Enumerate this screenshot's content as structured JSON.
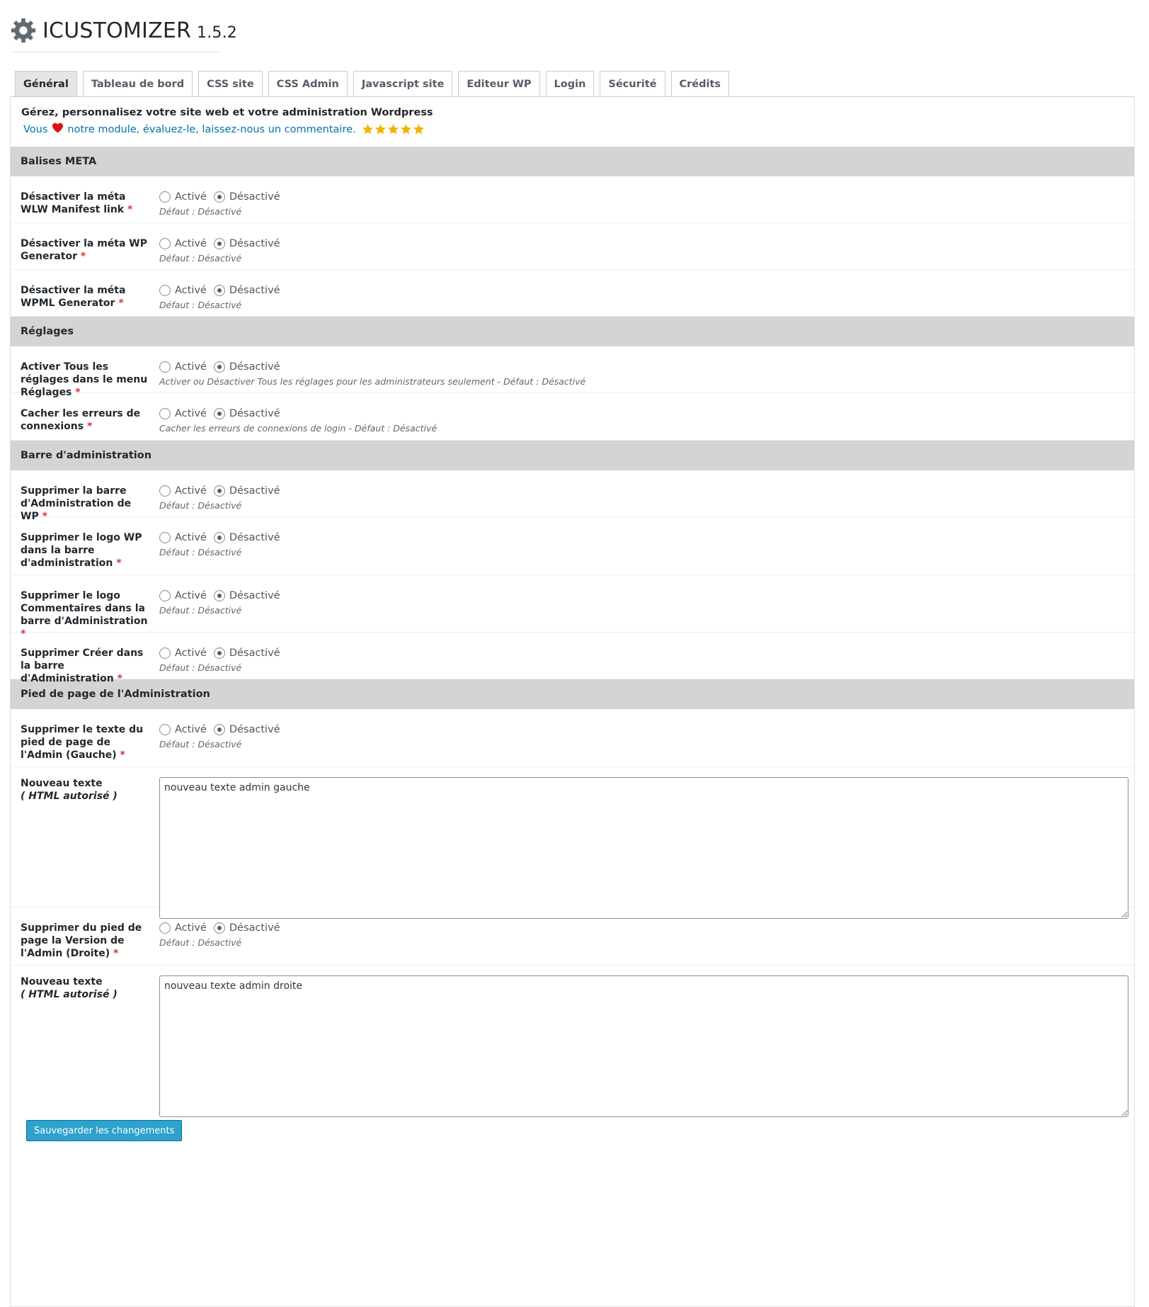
{
  "app": {
    "title": "ICUSTOMIZER",
    "version": "1.5.2"
  },
  "tabs": [
    {
      "label": "Général",
      "active": true
    },
    {
      "label": "Tableau de bord"
    },
    {
      "label": "CSS site"
    },
    {
      "label": "CSS Admin"
    },
    {
      "label": "Javascript site"
    },
    {
      "label": "Editeur WP"
    },
    {
      "label": "Login"
    },
    {
      "label": "Sécurité"
    },
    {
      "label": "Crédits"
    }
  ],
  "intro": {
    "title": "Gérez, personnalisez votre site web et votre administration Wordpress",
    "love_prefix": "Vous",
    "love_suffix": "notre module, évaluez-le, laissez-nous un commentaire.",
    "stars": 5
  },
  "radio_labels": {
    "on": "Activé",
    "off": "Désactivé"
  },
  "sections": [
    {
      "title": "Balises META",
      "rows": [
        {
          "label": "Désactiver la méta WLW Manifest link",
          "desc": "Défaut : Désactivé"
        },
        {
          "label": "Désactiver la méta WP Generator",
          "desc": "Défaut : Désactivé"
        },
        {
          "label": "Désactiver la méta WPML Generator",
          "desc": "Défaut : Désactivé"
        }
      ]
    },
    {
      "title": "Réglages",
      "rows": [
        {
          "label": "Activer Tous les réglages dans le menu Réglages",
          "desc": "Activer ou Désactiver Tous les réglages pour les administrateurs seulement - Défaut : Désactivé"
        },
        {
          "label": "Cacher les erreurs de connexions",
          "desc": "Cacher les erreurs de connexions de login - Défaut : Désactivé"
        }
      ]
    },
    {
      "title": "Barre d'administration",
      "rows": [
        {
          "label": "Supprimer la barre d'Administration de WP",
          "desc": "Défaut : Désactivé"
        },
        {
          "label": "Supprimer le logo WP dans la barre d'administration",
          "desc": "Défaut : Désactivé"
        },
        {
          "label": "Supprimer le logo Commentaires dans la barre d'Administration",
          "desc": "Défaut : Désactivé"
        },
        {
          "label": "Supprimer Créer dans la barre d'Administration",
          "desc": "Défaut : Désactivé"
        }
      ]
    },
    {
      "title": "Pied de page de l'Administration",
      "rows": [
        {
          "label": "Supprimer le texte du pied de page de l'Admin (Gauche)",
          "desc": "Défaut : Désactivé"
        },
        {
          "label": "Nouveau texte",
          "sublabel": "( HTML autorisé )",
          "textarea": "nouveau texte admin gauche"
        },
        {
          "label": "Supprimer du pied de page la Version de l'Admin (Droite)",
          "desc": "Défaut : Désactivé"
        },
        {
          "label": "Nouveau texte",
          "sublabel": "( HTML autorisé )",
          "textarea": "nouveau texte admin droite"
        }
      ]
    }
  ],
  "save_button": "Sauvegarder les changements",
  "colors": {
    "accent": "#2ea2cc",
    "link": "#0073aa",
    "required": "#dc3232",
    "star": "#f0b400",
    "heart": "#dd1111",
    "section_bg": "#d4d4d4"
  },
  "icons": {
    "logo": "gear-icon",
    "love": "heart-icon",
    "rating": "star-icon"
  }
}
